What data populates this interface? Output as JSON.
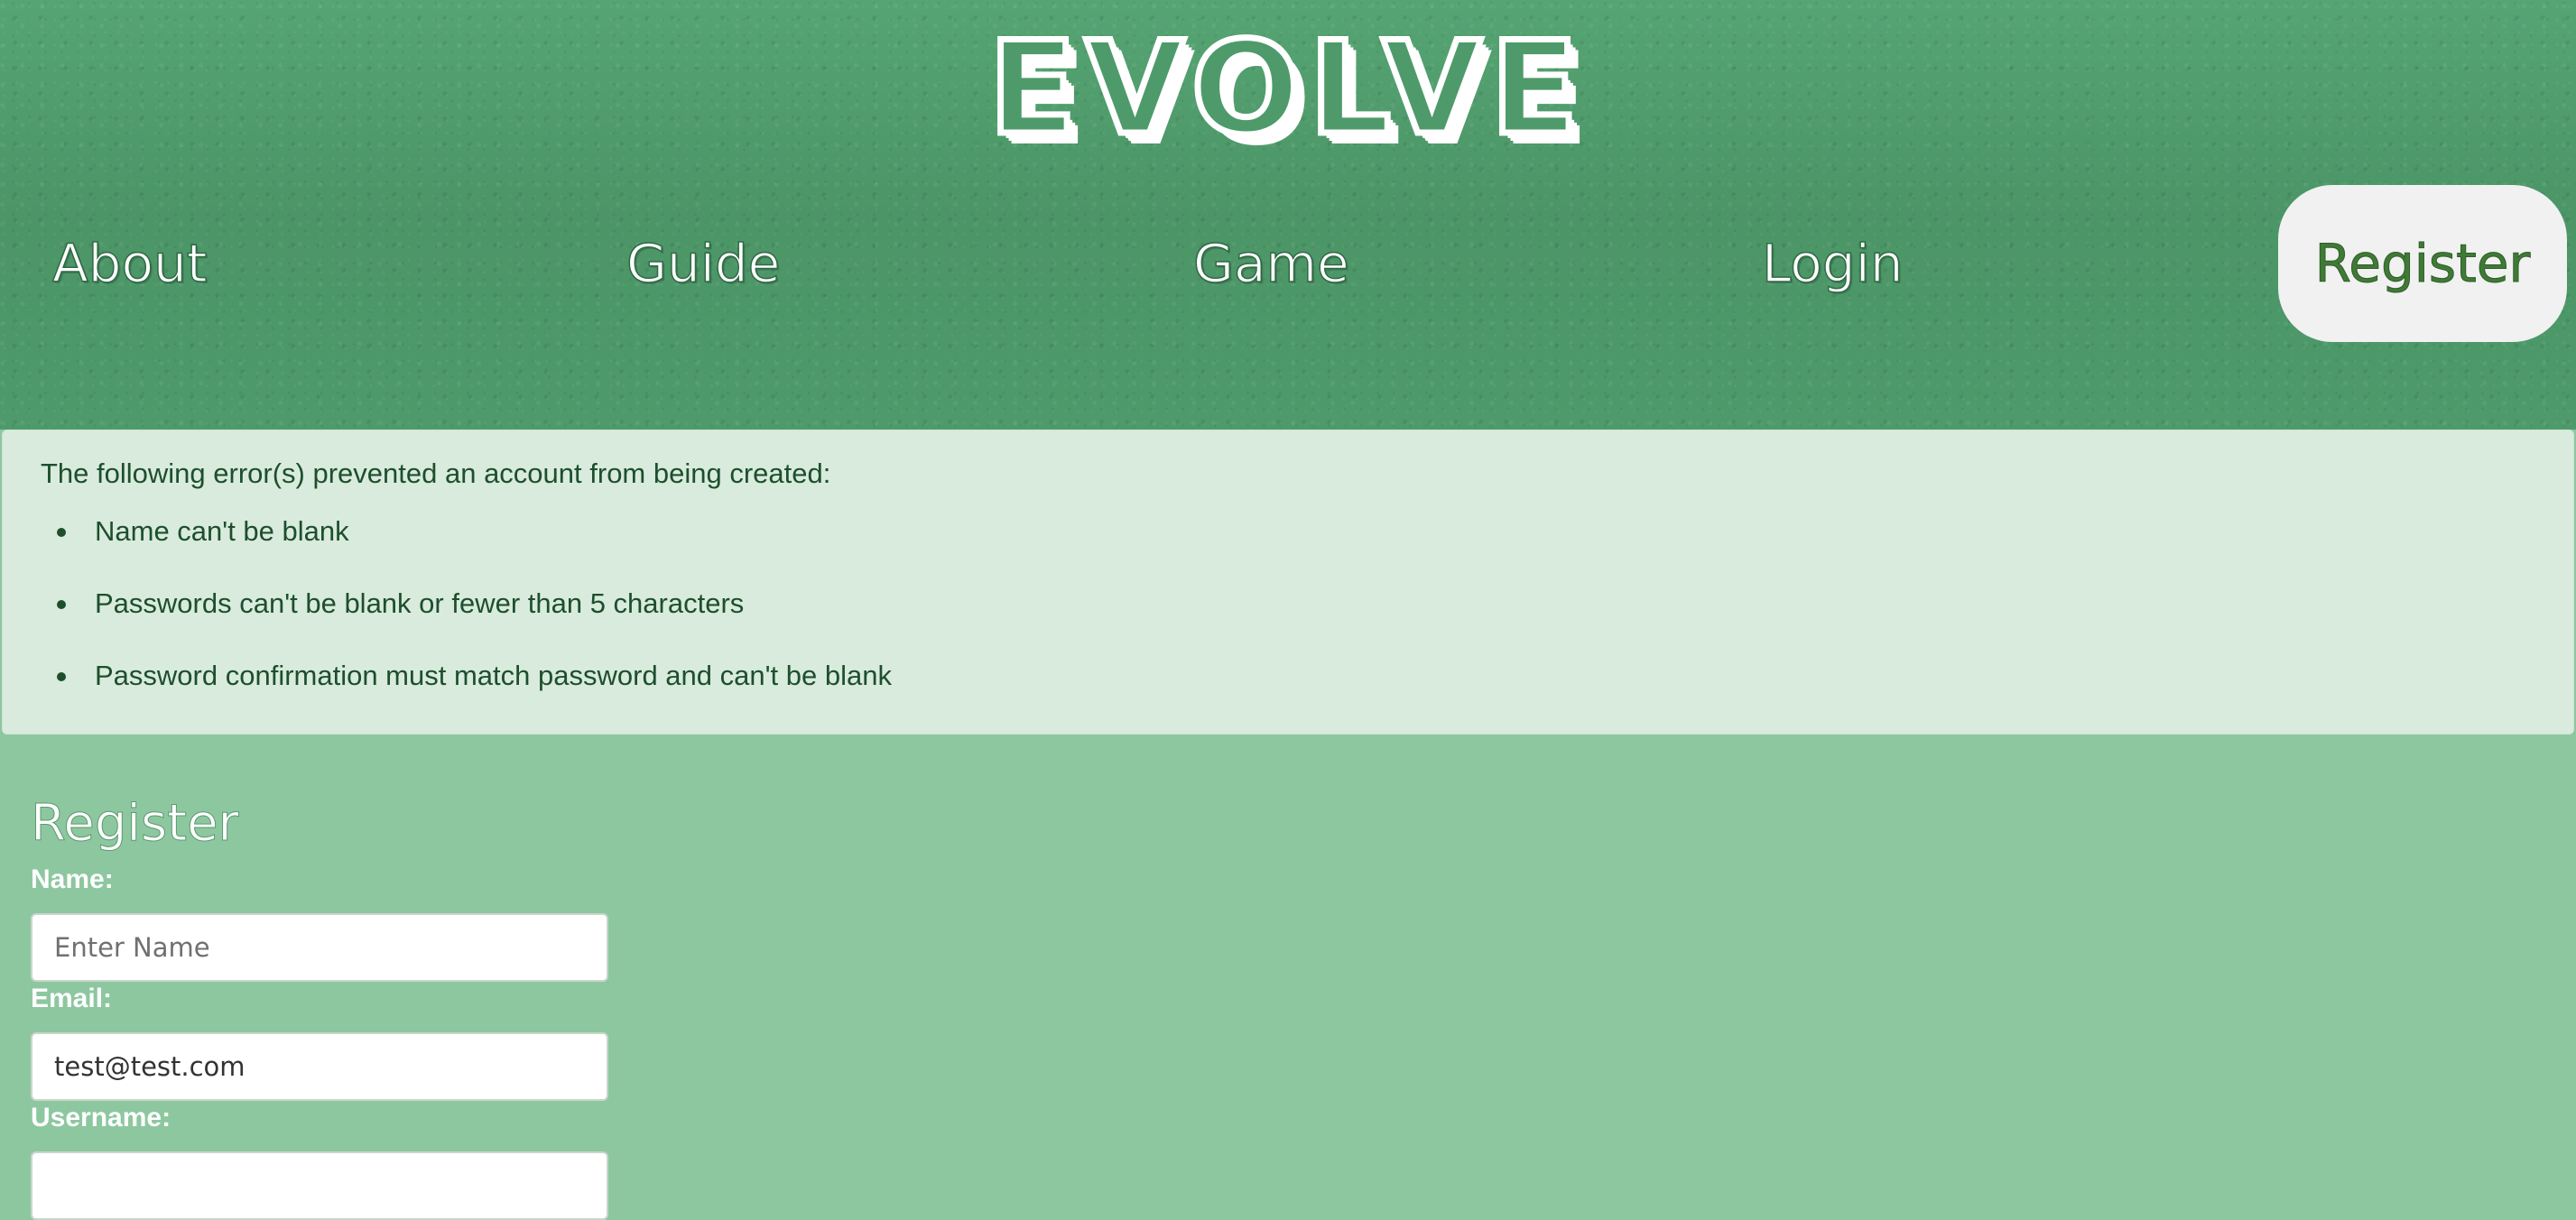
{
  "header": {
    "logo_text": "EVOLVE"
  },
  "nav": {
    "items": [
      {
        "label": "About"
      },
      {
        "label": "Guide"
      },
      {
        "label": "Game"
      },
      {
        "label": "Login"
      },
      {
        "label": "Register"
      }
    ],
    "active": "Register"
  },
  "errors": {
    "heading": "The following error(s) prevented an account from being created:",
    "items": [
      "Name can't be blank",
      "Passwords can't be blank or fewer than 5 characters",
      "Password confirmation must match password and can't be blank"
    ]
  },
  "form": {
    "title": "Register",
    "name_label": "Name:",
    "name_placeholder": "Enter Name",
    "name_value": "",
    "email_label": "Email:",
    "email_value": "test@test.com",
    "username_label": "Username:",
    "username_value": ""
  },
  "colors": {
    "header_green": "#4e9a6a",
    "page_green": "#8dc7a0",
    "error_bg": "#d9ebdd",
    "error_text": "#1d4f2d",
    "active_nav_bg": "#f1f1f1",
    "active_nav_text": "#3f7a36"
  }
}
